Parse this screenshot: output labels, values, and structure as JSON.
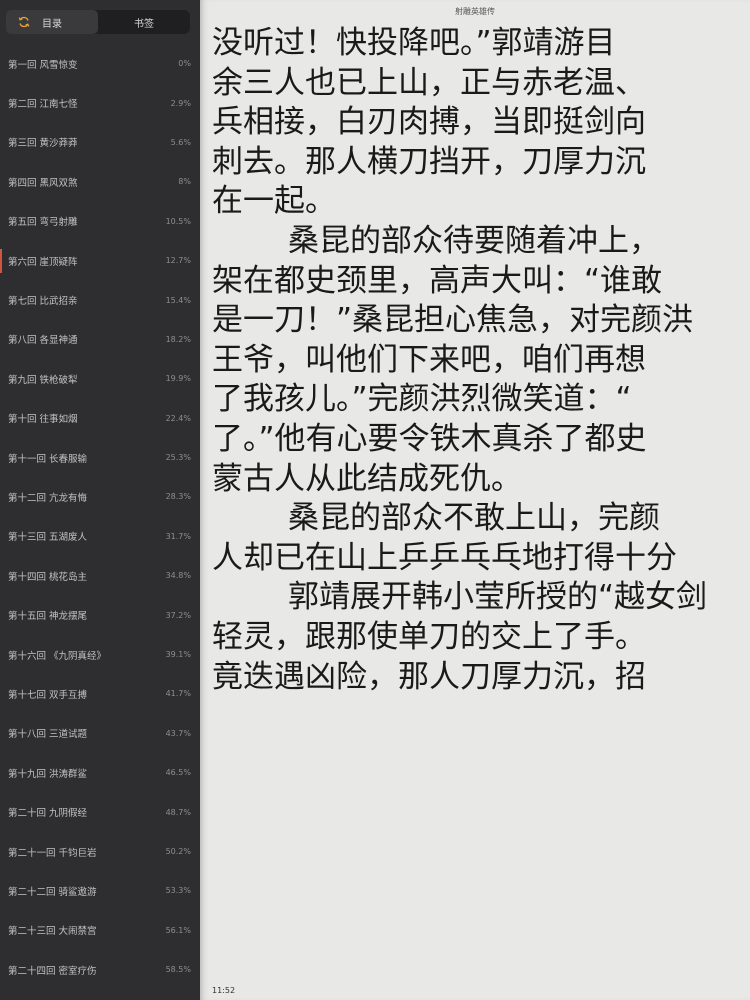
{
  "sidebar": {
    "tabs": [
      {
        "label": "目录"
      },
      {
        "label": "书签"
      }
    ],
    "chapters": [
      {
        "title": "第一回 风雪惊变",
        "progress": "0%"
      },
      {
        "title": "第二回 江南七怪",
        "progress": "2.9%"
      },
      {
        "title": "第三回 黄沙莽莽",
        "progress": "5.6%"
      },
      {
        "title": "第四回 黑风双煞",
        "progress": "8%"
      },
      {
        "title": "第五回 弯弓射雕",
        "progress": "10.5%"
      },
      {
        "title": "第六回 崖顶疑阵",
        "progress": "12.7%"
      },
      {
        "title": "第七回 比武招亲",
        "progress": "15.4%"
      },
      {
        "title": "第八回 各显神通",
        "progress": "18.2%"
      },
      {
        "title": "第九回 铁枪破犁",
        "progress": "19.9%"
      },
      {
        "title": "第十回 往事如烟",
        "progress": "22.4%"
      },
      {
        "title": "第十一回 长春服输",
        "progress": "25.3%"
      },
      {
        "title": "第十二回 亢龙有悔",
        "progress": "28.3%"
      },
      {
        "title": "第十三回 五湖废人",
        "progress": "31.7%"
      },
      {
        "title": "第十四回 桃花岛主",
        "progress": "34.8%"
      },
      {
        "title": "第十五回 神龙摆尾",
        "progress": "37.2%"
      },
      {
        "title": "第十六回 《九阴真经》",
        "progress": "39.1%"
      },
      {
        "title": "第十七回 双手互搏",
        "progress": "41.7%"
      },
      {
        "title": "第十八回 三道试题",
        "progress": "43.7%"
      },
      {
        "title": "第十九回 洪涛群鲨",
        "progress": "46.5%"
      },
      {
        "title": "第二十回 九阴假经",
        "progress": "48.7%"
      },
      {
        "title": "第二十一回 千钧巨岩",
        "progress": "50.2%"
      },
      {
        "title": "第二十二回 骑鲨遨游",
        "progress": "53.3%"
      },
      {
        "title": "第二十三回 大闹禁宫",
        "progress": "56.1%"
      },
      {
        "title": "第二十四回 密室疗伤",
        "progress": "58.5%"
      }
    ]
  },
  "reader": {
    "book_title": "射雕英雄传",
    "time": "11:52",
    "lines": [
      "没听过！快投降吧。”郭靖游目",
      "余三人也已上山，正与赤老温、",
      "兵相接，白刃肉搏，当即挺剑向",
      "刺去。那人横刀挡开，刀厚力沉",
      "在一起。",
      "桑昆的部众待要随着冲上，",
      "架在都史颈里，高声大叫：“谁敢",
      "是一刀！”桑昆担心焦急，对完颜洪",
      "王爷，叫他们下来吧，咱们再想",
      "了我孩儿。”完颜洪烈微笑道：“",
      "了。”他有心要令铁木真杀了都史",
      "蒙古人从此结成死仇。",
      "桑昆的部众不敢上山，完颜",
      "人却已在山上乒乒乓乓地打得十分",
      "郭靖展开韩小莹所授的“越女剑",
      "轻灵，跟那使单刀的交上了手。",
      "竟迭遇凶险，那人刀厚力沉，招"
    ]
  },
  "colors": {
    "sidebar_bg": "#2e2e30",
    "page_bg": "#e8e8e6",
    "accent": "#e8a33a",
    "current_marker": "#d0563d"
  }
}
